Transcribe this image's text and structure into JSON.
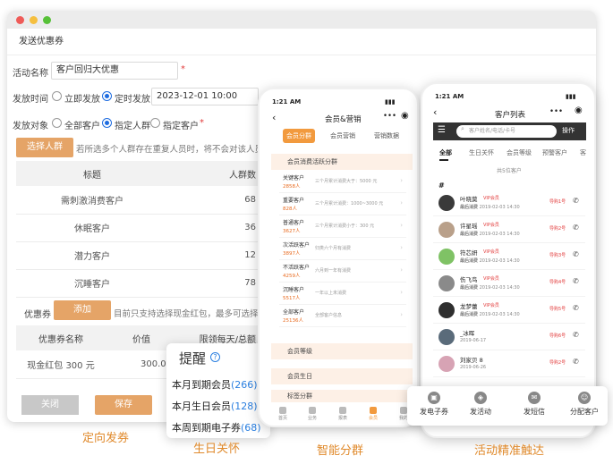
{
  "window": {
    "title": "发送优惠券",
    "activity_name_label": "活动名称",
    "activity_name_value": "客户回归大优惠",
    "send_time_label": "发放时间",
    "send_now": "立即发放",
    "send_scheduled": "定时发放",
    "send_datetime": "2023-12-01 10:00",
    "send_target_label": "发放对象",
    "target_all": "全部客户",
    "target_group": "指定人群",
    "target_specific": "指定客户",
    "choose_group_button": "选择人群",
    "group_hint": "若所选多个人群存在重复人员时，将不会对该人员",
    "table_headers": [
      "标题",
      "人群数"
    ],
    "table_rows": [
      {
        "title": "需刺激消费客户",
        "count": "68"
      },
      {
        "title": "休眠客户",
        "count": "36"
      },
      {
        "title": "潜力客户",
        "count": "12"
      },
      {
        "title": "沉睡客户",
        "count": "78"
      }
    ],
    "coupon_label": "优惠券",
    "add_button": "添加",
    "coupon_hint": "目前只支持选择现金红包，最多可选择",
    "coupon_headers": [
      "优惠券名称",
      "价值",
      "限领每天/总额"
    ],
    "coupon_rows": [
      {
        "name": "现金红包 300 元",
        "value": "300.00"
      }
    ],
    "close_button": "关闭",
    "save_button": "保存"
  },
  "remind": {
    "title": "提醒",
    "lines": [
      {
        "label": "本月到期会员",
        "count": "(266)"
      },
      {
        "label": "本月生日会员",
        "count": "(128)"
      },
      {
        "label": "本周到期电子券",
        "count": "(68)"
      }
    ]
  },
  "captions": [
    "定向发券",
    "生日关怀",
    "智能分群",
    "活动精准触达"
  ],
  "phone1": {
    "time": "1:21 AM",
    "title": "会员&营销",
    "segments": [
      "会员分群",
      "会员营销",
      "营销数据"
    ],
    "section1": "会员消费活跃分群",
    "items": [
      {
        "name": "关键客户",
        "count": "2858人",
        "desc": "三个月累计消费大于：5000 元"
      },
      {
        "name": "重要客户",
        "count": "828人",
        "desc": "三个月累计消费：1000~3000 元"
      },
      {
        "name": "普通客户",
        "count": "3627人",
        "desc": "三个月累计消费小于：300 元"
      },
      {
        "name": "次活跃客户",
        "count": "3897人",
        "desc": "归类六个月有消费"
      },
      {
        "name": "不活跃客户",
        "count": "4259人",
        "desc": "六月到一年有消费"
      },
      {
        "name": "沉睡客户",
        "count": "5517人",
        "desc": "一年以上未消费"
      },
      {
        "name": "全部客户",
        "count": "25136人",
        "desc": "全部客户信息"
      }
    ],
    "section2": "会员等级",
    "section3": "会员生日",
    "section4": "标签分群",
    "tabbar": [
      "首页",
      "业务",
      "报表",
      "会员",
      "我的"
    ]
  },
  "phone2": {
    "time": "1:21 AM",
    "title": "客户列表",
    "search_placeholder": "客户姓名/电话/卡号",
    "operate": "操作",
    "tabs": [
      "全部",
      "生日关怀",
      "会员等级",
      "预警客户",
      "客"
    ],
    "total": "共5位客户",
    "index": "#",
    "vip": "VIP会员",
    "last_label": "最后消费",
    "rows": [
      {
        "name": "叶晓莫",
        "date": "2019-02-03 14:30",
        "tag": "导购1号"
      },
      {
        "name": "许星瑶",
        "date": "2019-02-03 14:30",
        "tag": "导购2号"
      },
      {
        "name": "符芯妍",
        "date": "2019-02-03 14:30",
        "tag": "导购3号"
      },
      {
        "name": "伤飞鸟",
        "date": "2019-02-03 14:30",
        "tag": "导购4号"
      },
      {
        "name": "龙梦蕾",
        "date": "2019-02-03 14:30",
        "tag": "导购5号"
      },
      {
        "name": "_冰晖",
        "date": "2019-06-17",
        "tag": "导购6号"
      },
      {
        "name": "刘家贝 8",
        "date": "2019-06-26",
        "tag": "导购2号"
      }
    ],
    "actions": [
      "发电子券",
      "发活动",
      "发短信",
      "分配客户"
    ]
  }
}
